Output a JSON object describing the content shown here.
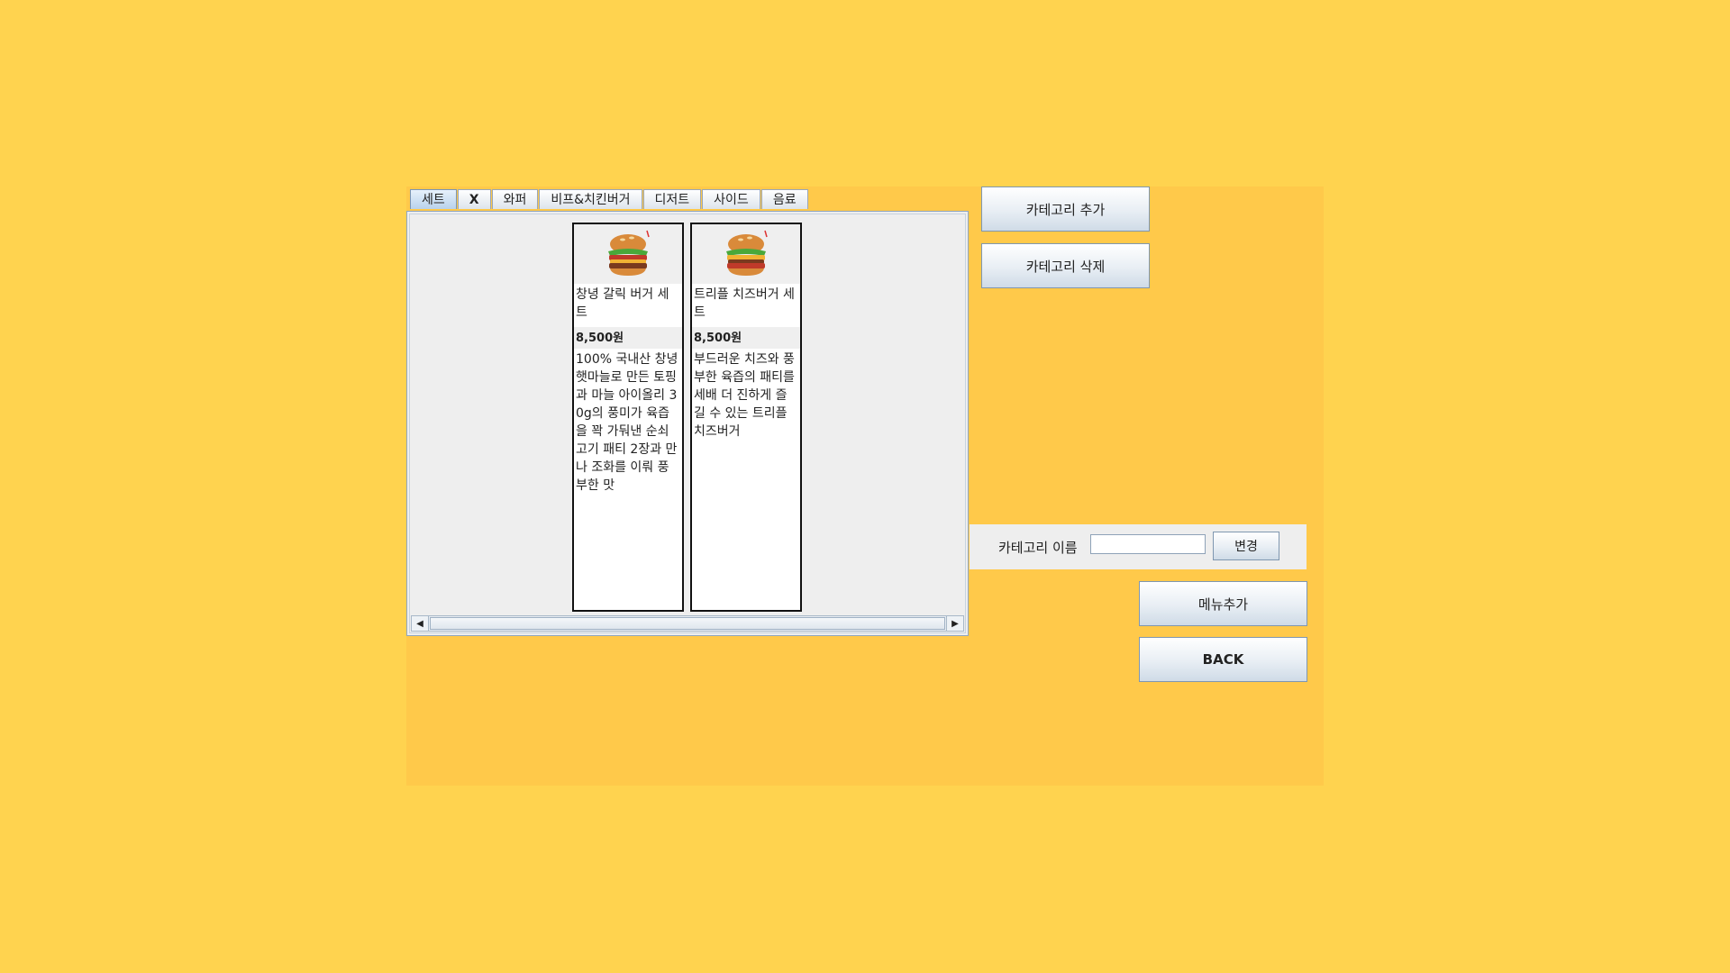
{
  "tabs": [
    {
      "label": "세트",
      "active": true
    },
    {
      "label": "X",
      "active": false
    },
    {
      "label": "와퍼",
      "active": false
    },
    {
      "label": "비프&치킨버거",
      "active": false
    },
    {
      "label": "디저트",
      "active": false
    },
    {
      "label": "사이드",
      "active": false
    },
    {
      "label": "음료",
      "active": false
    }
  ],
  "menu_items": [
    {
      "name": "창녕 갈릭 버거 세트",
      "price": "8,500원",
      "description": "100% 국내산 창녕 햇마늘로 만든 토핑과 마늘 아이올리 30g의 풍미가 육즙을 꽉 가둬낸 순쇠고기 패티 2장과 만나 조화를 이뤄 풍부한 맛",
      "image_icon": "burger-icon"
    },
    {
      "name": "트리플 치즈버거 세트",
      "price": "8,500원",
      "description": "부드러운 치즈와 풍부한 육즙의 패티를 세배 더 진하게 즐길 수 있는 트리플 치즈버거",
      "image_icon": "burger-icon"
    }
  ],
  "buttons": {
    "add_category": "카테고리 추가",
    "delete_category": "카테고리 삭제",
    "rename": "변경",
    "add_menu": "메뉴추가",
    "back": "BACK"
  },
  "rename": {
    "label": "카테고리 이름",
    "value": ""
  },
  "colors": {
    "background": "#FFD34F",
    "panel": "#FFC94A",
    "content_bg": "#EEEEEE"
  }
}
